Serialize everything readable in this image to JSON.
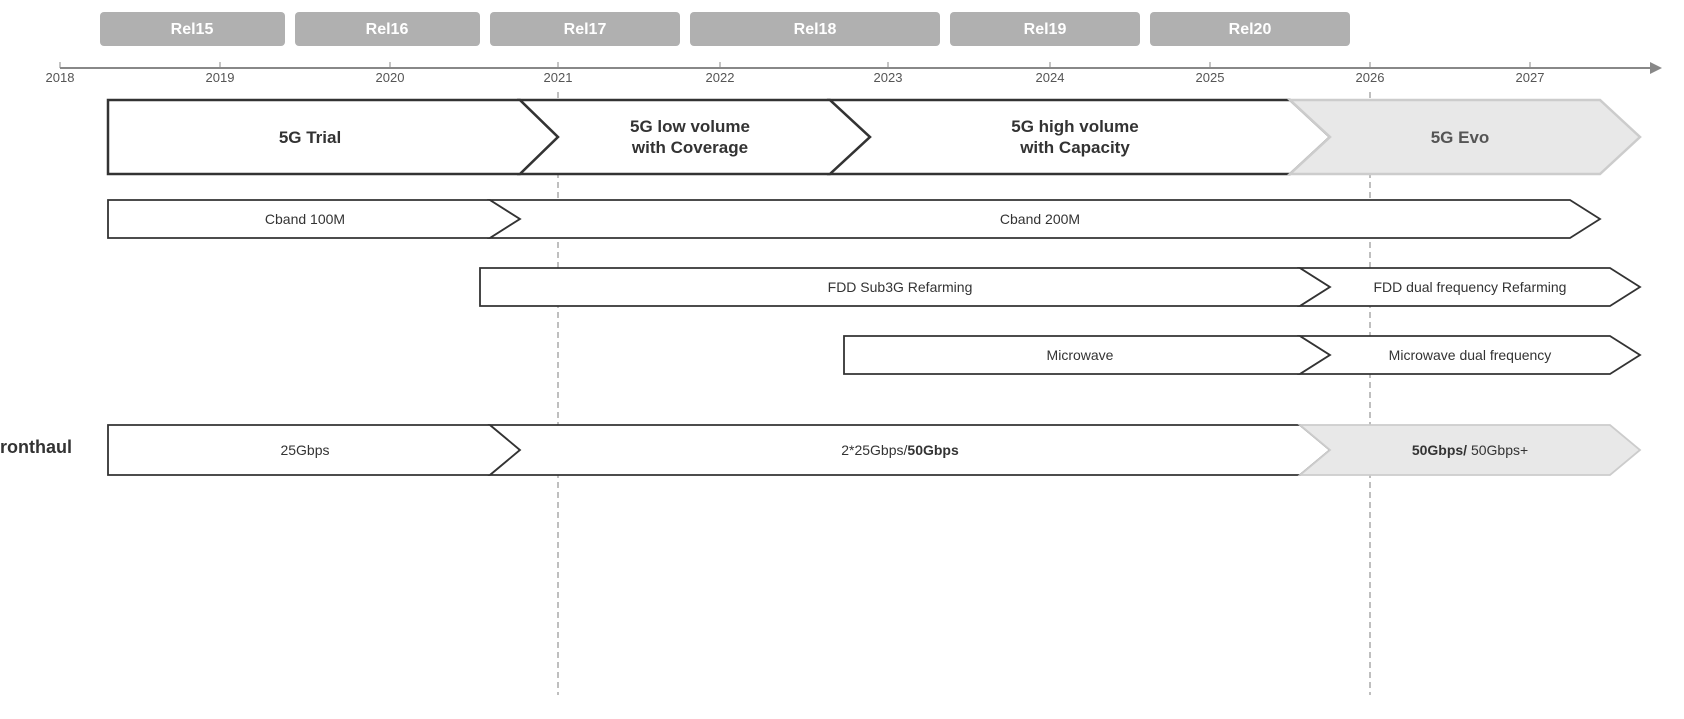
{
  "timeline": {
    "releases": [
      {
        "label": "Rel15",
        "startPct": 0,
        "widthPct": 14.5
      },
      {
        "label": "Rel16",
        "startPct": 15.5,
        "widthPct": 14.5
      },
      {
        "label": "Rel17",
        "startPct": 31,
        "widthPct": 14.5
      },
      {
        "label": "Rel18",
        "startPct": 46.5,
        "widthPct": 19
      },
      {
        "label": "Rel19",
        "startPct": 66.5,
        "widthPct": 14
      },
      {
        "label": "Rel20",
        "startPct": 81.5,
        "widthPct": 14
      }
    ],
    "years": [
      "2018",
      "2019",
      "2020",
      "2021",
      "2022",
      "2023",
      "2024",
      "2025",
      "2026",
      "2027"
    ],
    "yearPositions": [
      0,
      10.5,
      21,
      31.5,
      42,
      52.5,
      63,
      73.5,
      84,
      94.5
    ]
  },
  "phases": {
    "trial": "5G Trial",
    "lowVolume": "5G low volume\nwith Coverage",
    "highVolume": "5G high volume\nwith Capacity",
    "evo": "5G Evo"
  },
  "rows": {
    "cband100": "Cband 100M",
    "cband200": "Cband 200M",
    "fddSub3g": "FDD Sub3G Refarming",
    "fddDual": "FDD dual frequency Refarming",
    "microwave": "Microwave",
    "microwaveDual": "Microwave dual frequency"
  },
  "fronthaul": {
    "label": "Fronthaul",
    "v1": "25Gbps",
    "v2": "2*25Gbps/",
    "v2bold": "50Gbps",
    "v3bold": "50Gbps/",
    "v3": " 50Gbps+"
  },
  "colors": {
    "relBar": "#b0b0b0",
    "relBarText": "#ffffff",
    "arrowStroke": "#333333",
    "arrowFill": "#ffffff",
    "grayArrowFill": "#e8e8e8",
    "dashedLine": "#aaaaaa"
  }
}
